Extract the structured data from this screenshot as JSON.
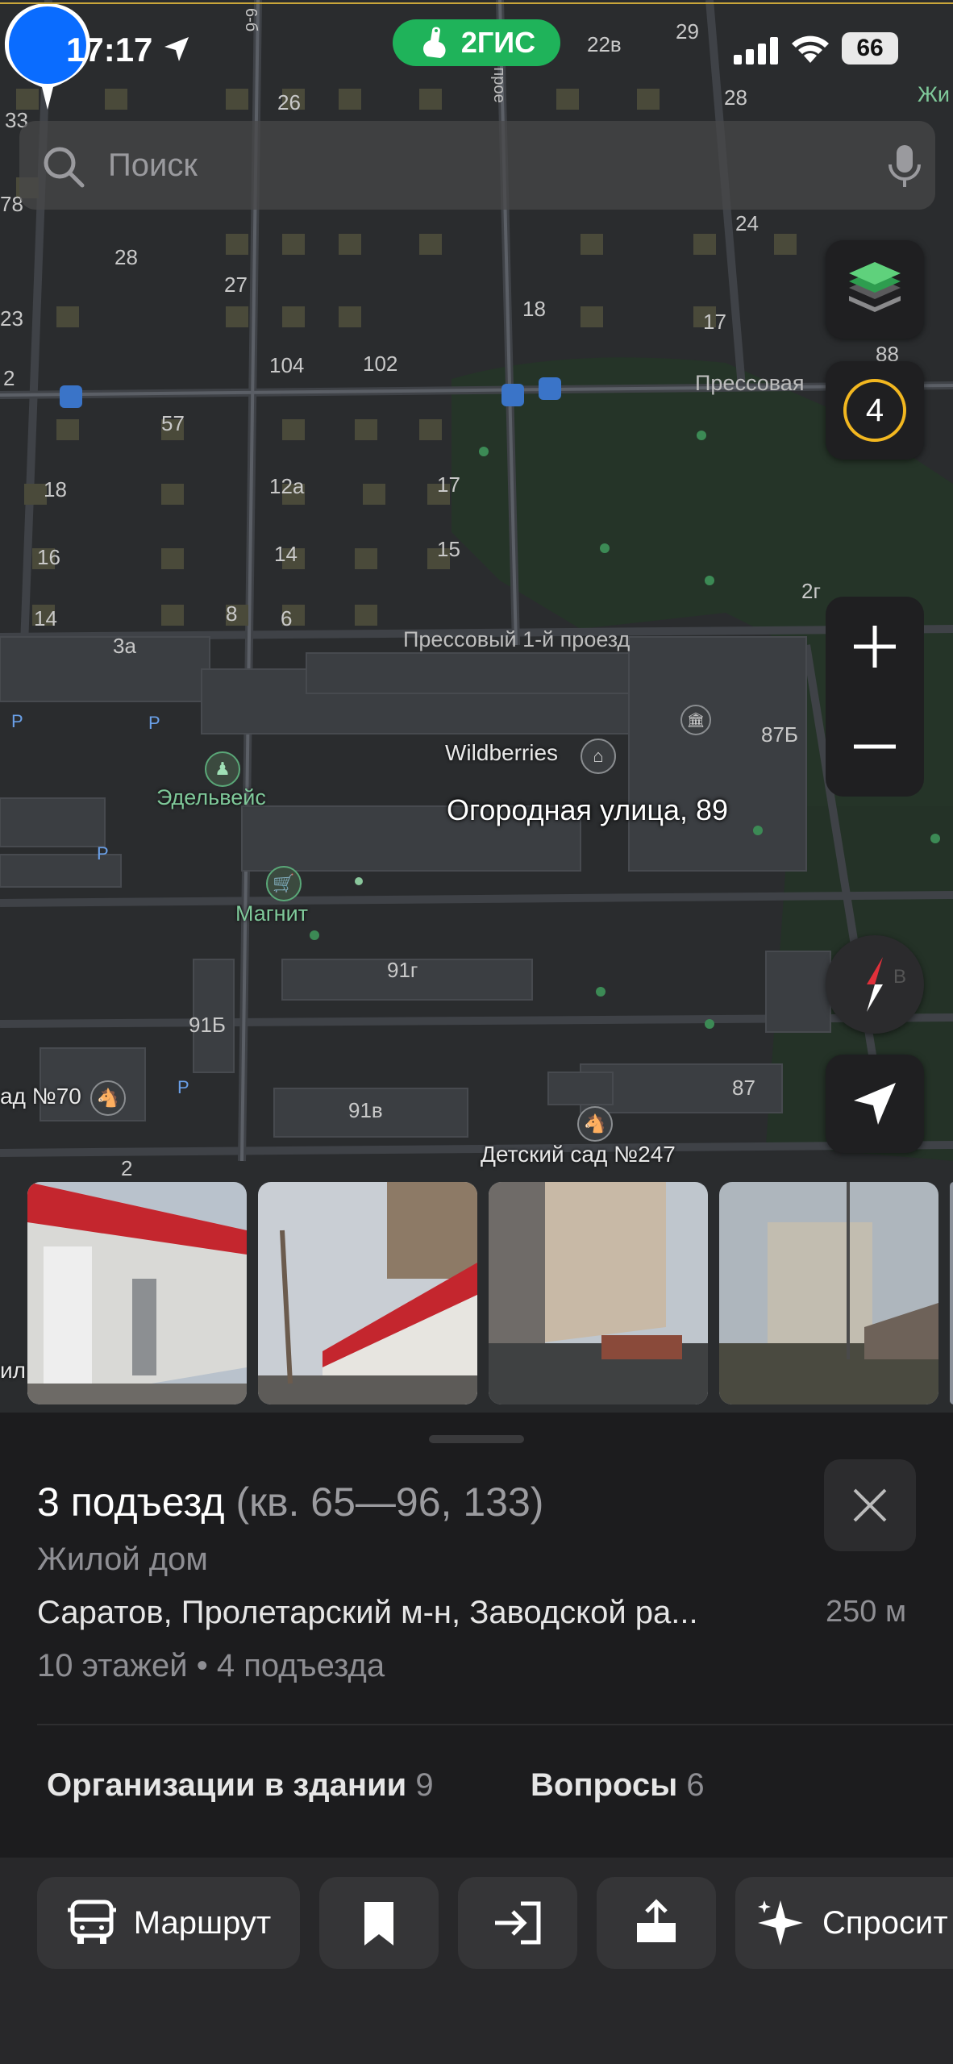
{
  "status_bar": {
    "time": "17:17",
    "battery": "66"
  },
  "brand": {
    "name": "2ГИС"
  },
  "search": {
    "placeholder": "Поиск"
  },
  "map": {
    "level_badge": "4",
    "address_label": "Огородная улица, 89",
    "house_numbers": [
      "6-б",
      "26",
      "22в",
      "29",
      "28",
      "33",
      "78",
      "28",
      "27",
      "23",
      "18",
      "24",
      "17",
      "2",
      "104",
      "102",
      "88",
      "57",
      "18",
      "12а",
      "17",
      "16",
      "14",
      "15",
      "14",
      "8",
      "6",
      "2г",
      "3а",
      "87Б",
      "91г",
      "91Б",
      "91в",
      "87",
      "2"
    ],
    "streets": [
      "Прессовая",
      "Прессовый 1-й проезд",
      "Жи",
      "-й прое"
    ],
    "pois": [
      "Wildberries",
      "Эдельвейс",
      "Магнит",
      "Детский сад №247",
      "ад №70",
      "ил"
    ],
    "parking_marker": "P",
    "compass_marker": "В"
  },
  "place": {
    "title": "3 подъезд",
    "title_suffix": "(кв. 65—96, 133)",
    "type": "Жилой дом",
    "address": "Саратов, Пролетарский м-н, Заводской ра...",
    "distance": "250 м",
    "floors": "10 этажей • 4 подъезда"
  },
  "tabs": [
    {
      "label": "Организации в здании",
      "count": "9"
    },
    {
      "label": "Вопросы",
      "count": "6"
    }
  ],
  "actions": {
    "route_label": "Маршрут",
    "ask_label": "Спросит"
  },
  "colors": {
    "accent_green": "#1fb35a",
    "pin_blue": "#0a6cff",
    "level_ring": "#f2b720"
  }
}
